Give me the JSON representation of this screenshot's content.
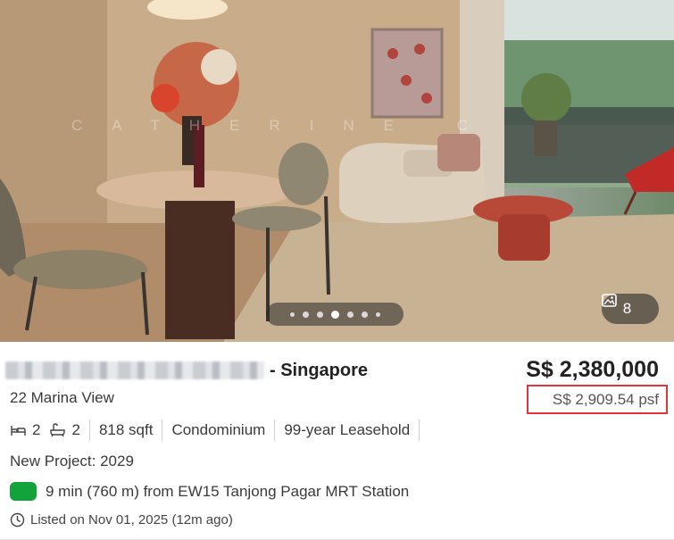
{
  "listing": {
    "title_suffix": "- Singapore",
    "address": "22 Marina View",
    "price": "S$ 2,380,000",
    "psf": "S$ 2,909.54 psf",
    "specs": {
      "bedrooms": "2",
      "bathrooms": "2",
      "area": "818 sqft",
      "property_type": "Condominium",
      "tenure": "99-year Leasehold"
    },
    "project": "New Project: 2029",
    "mrt": "9 min (760 m) from EW15 Tanjong Pagar MRT Station",
    "listed": "Listed on Nov 01, 2025 (12m ago)"
  },
  "gallery": {
    "photo_count": "8",
    "watermark": "CATHERINE C",
    "dots": 7,
    "active_dot": 4
  },
  "colors": {
    "price_text": "#222222",
    "highlight_border": "#e0353b",
    "mrt_badge": "#12a33b"
  },
  "icons": {
    "bed": "bed-icon",
    "bath": "bathtub-icon",
    "photos": "image-icon",
    "clock": "clock-icon"
  }
}
